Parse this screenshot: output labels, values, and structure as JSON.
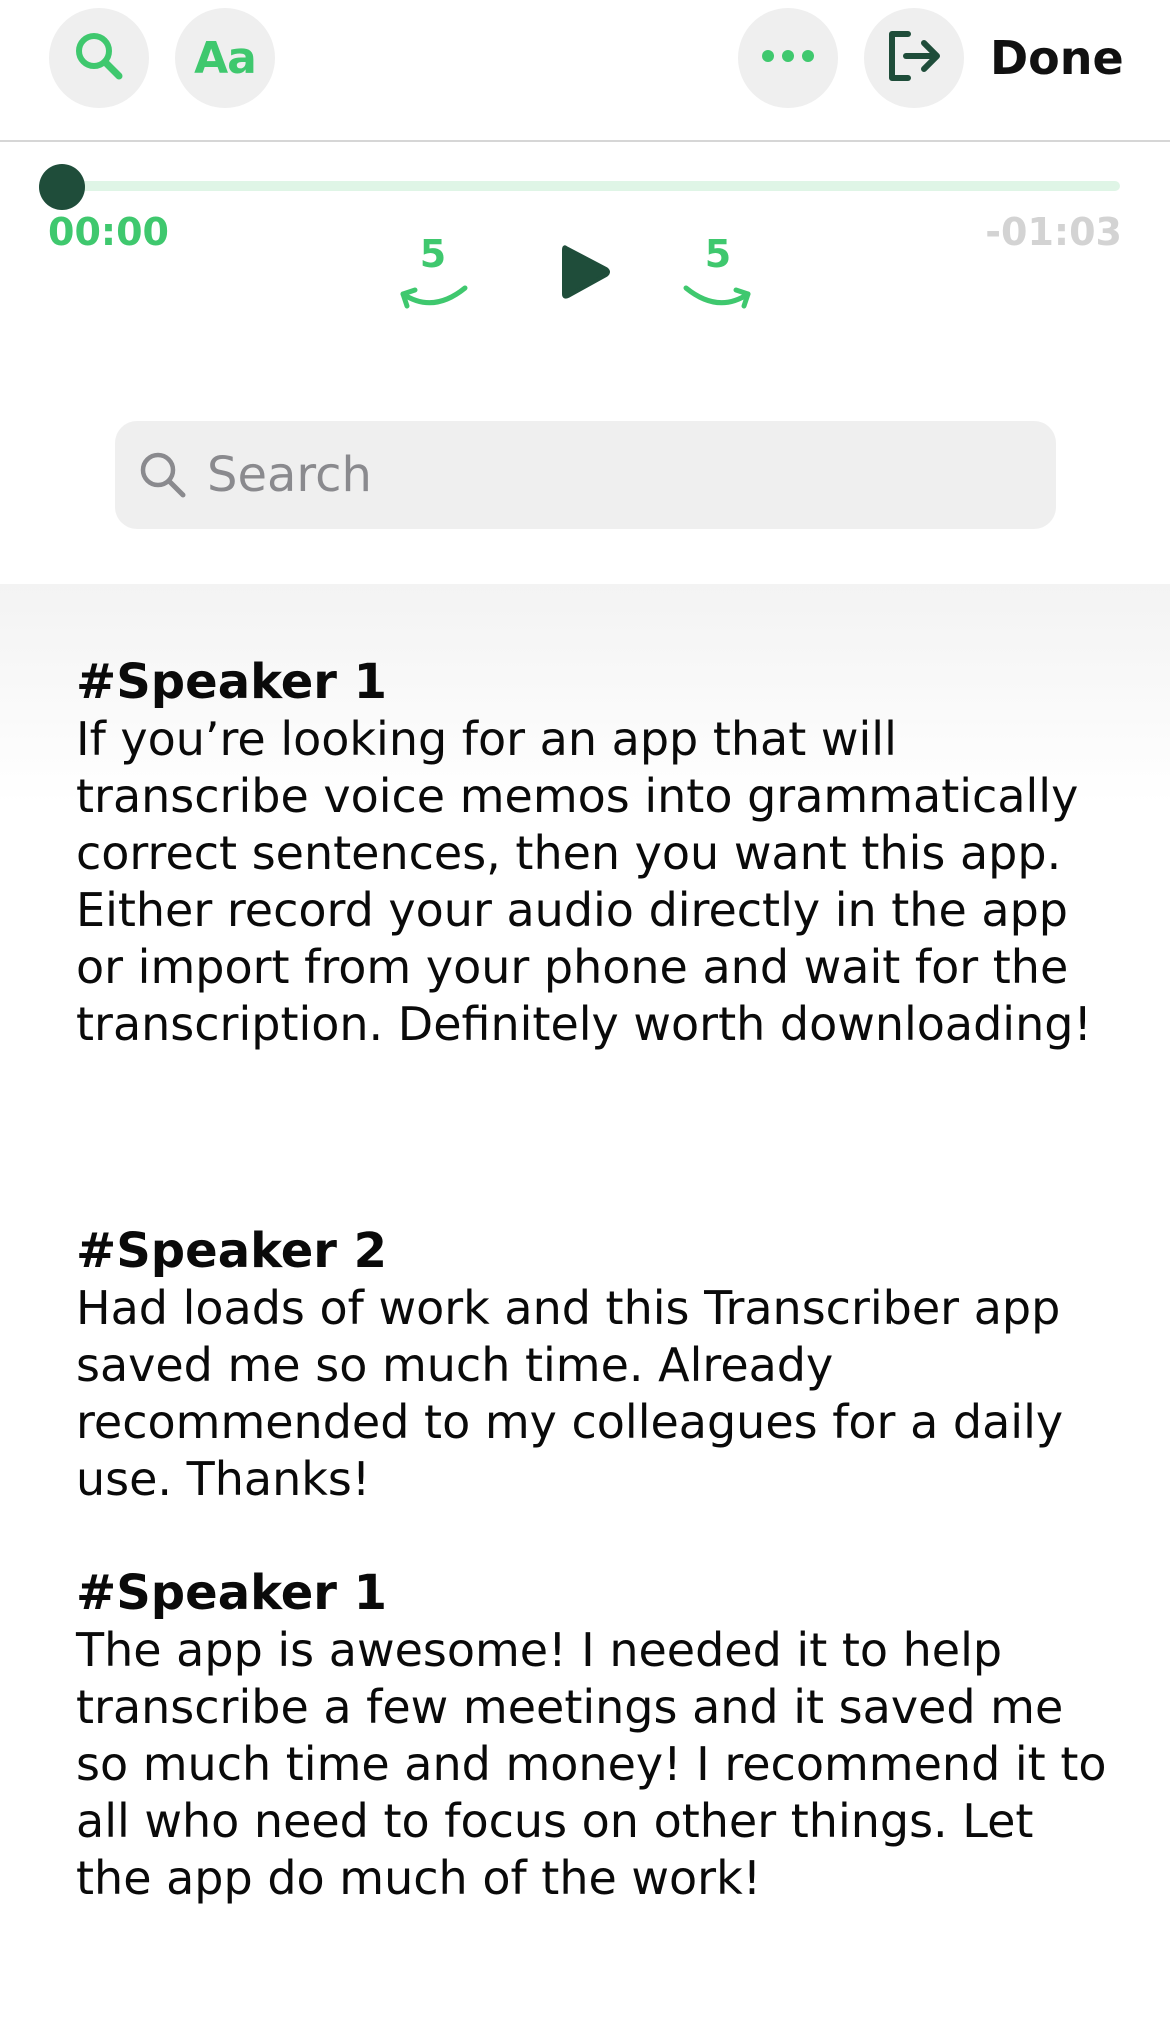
{
  "toolbar": {
    "search_icon": "search-icon",
    "font_label": "Aa",
    "more_icon": "more-icon",
    "export_icon": "export-icon",
    "done_label": "Done",
    "accent_color": "#3fc86e",
    "dark_accent_color": "#1f4d3a"
  },
  "player": {
    "elapsed": "00:00",
    "remaining": "-01:03",
    "progress": 0,
    "skip_back_label": "5",
    "skip_forward_label": "5",
    "play_icon": "play-icon"
  },
  "search": {
    "placeholder": "Search",
    "value": ""
  },
  "transcript": {
    "segments": [
      {
        "speaker": "#Speaker 1",
        "text": "If you’re looking for an app that will transcribe voice memos into grammatically correct sentences, then you want this app. Either record your audio directly in the app or import from your phone and wait for the transcription. Definitely worth downloading!"
      },
      {
        "speaker": "#Speaker 2",
        "text": "Had loads of work and this Transcriber app saved me so much time. Already recommended to my colleagues for a daily use. Thanks!"
      },
      {
        "speaker": "#Speaker 1",
        "text": "The app is awesome! I needed it to help transcribe a few meetings and it saved me so much time and money! I recommend it to all who need to focus on other things. Let the app do much of the work!"
      }
    ]
  }
}
